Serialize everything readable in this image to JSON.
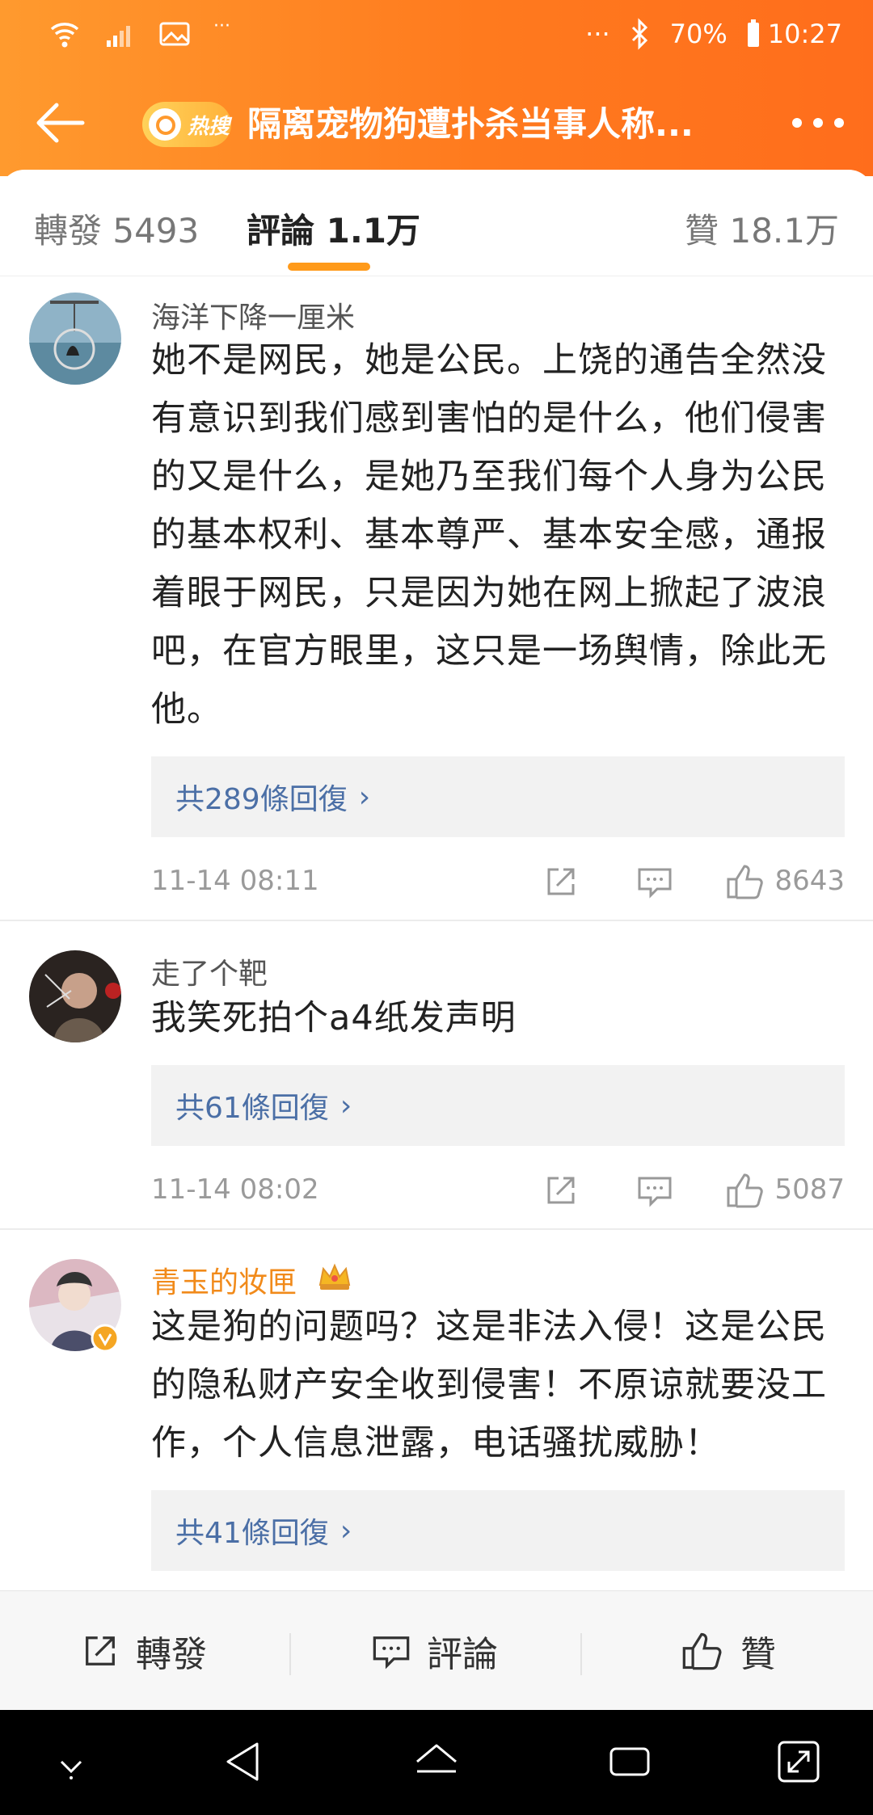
{
  "status": {
    "battery": "70%",
    "time": "10:27",
    "dots": "···",
    "dots2": "···"
  },
  "nav": {
    "hot_label": "热搜",
    "title": "隔离宠物狗遭扑杀当事人称..."
  },
  "tabs": {
    "repost": "轉發 5493",
    "comments": "評論 1.1万",
    "likes": "贊 18.1万"
  },
  "comments": [
    {
      "user": "海洋下降一厘米",
      "text": "她不是网民，她是公民。上饶的通告全然没有意识到我们感到害怕的是什么，他们侵害的又是什么，是她乃至我们每个人身为公民的基本权利、基本尊严、基本安全感，通报着眼于网民，只是因为她在网上掀起了波浪吧，在官方眼里，这只是一场舆情，除此无他。",
      "replies": "共289條回復",
      "time": "11-14 08:11",
      "likes": "8643"
    },
    {
      "user": "走了个靶",
      "text": "我笑死拍个a4纸发声明",
      "replies": "共61條回復",
      "time": "11-14 08:02",
      "likes": "5087"
    },
    {
      "user": "青玉的妆匣",
      "text": "这是狗的问题吗？这是非法入侵！这是公民的隐私财产安全收到侵害！不原谅就要没工作，个人信息泄露，电话骚扰威胁！",
      "replies": "共41條回復"
    }
  ],
  "bottom": {
    "repost": "轉發",
    "comment": "評論",
    "like": "贊"
  },
  "colors": {
    "header": "#ff7a1e",
    "accent": "#ff9a1a",
    "link": "#4b6fa6",
    "vip": "#f18a1a"
  }
}
